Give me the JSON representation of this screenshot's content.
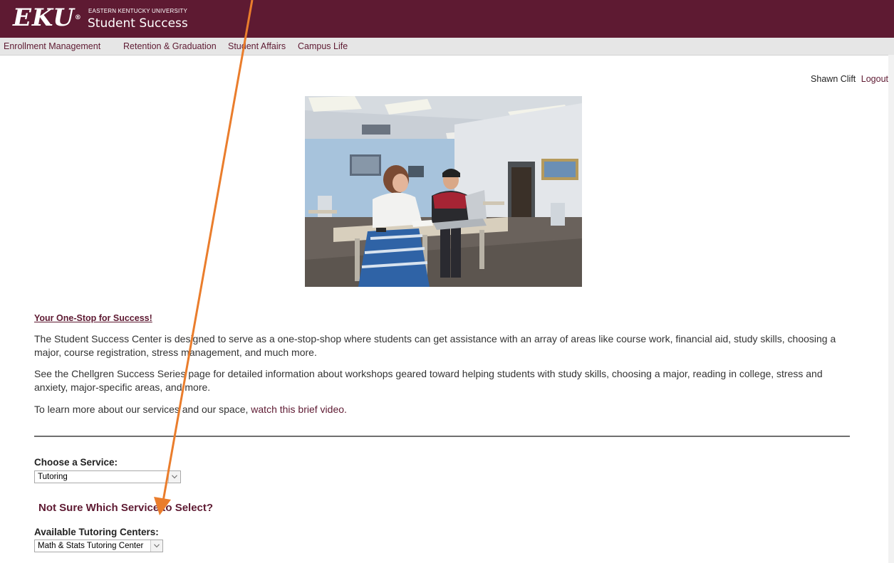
{
  "header": {
    "logo": "EKU",
    "university": "EASTERN KENTUCKY UNIVERSITY",
    "site_title": "Student Success"
  },
  "nav": {
    "items": [
      {
        "label": "Enrollment Management"
      },
      {
        "label": "Retention & Graduation"
      },
      {
        "label": "Student Affairs"
      },
      {
        "label": "Campus Life"
      }
    ]
  },
  "user": {
    "name": "Shawn Clift",
    "logout_label": "Logout"
  },
  "content": {
    "title": "Your One-Stop for Success!",
    "para1": "The Student Success Center is designed to serve as a one-stop-shop where students can get assistance with an array of areas like course work, financial aid, study skills, choosing a major, course registration, stress management, and much more.",
    "para2": "See the Chellgren Success Series page for detailed information about workshops geared toward helping students with study skills, choosing a major, reading in college, stress and anxiety, major-specific areas, and more.",
    "para3_prefix": "To learn more about our services and our space, ",
    "video_link": "watch this brief video."
  },
  "service": {
    "label": "Choose a Service:",
    "selected": "Tutoring"
  },
  "not_sure": "Not Sure Which Service to Select?",
  "centers": {
    "label": "Available Tutoring Centers:",
    "selected": "Math & Stats Tutoring Center"
  },
  "colors": {
    "brand": "#5e1a32",
    "nav_bg": "#e6e6e6",
    "annotation_arrow": "#ea7d2c"
  }
}
